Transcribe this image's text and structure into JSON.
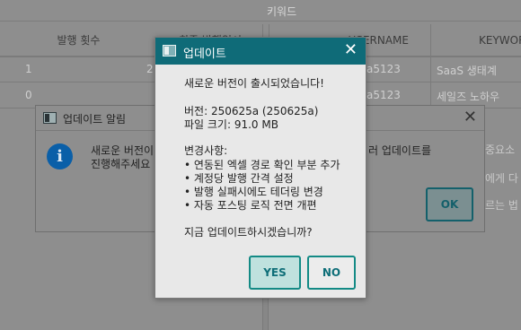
{
  "background": {
    "keyword_header": "키워드",
    "table": {
      "col_publish_count": "발행 횟수",
      "col_recent_partial": "최종 발행일시",
      "col_username": "USERNAME",
      "col_keyword_partial": "KEYWORD",
      "rows": [
        {
          "publish_count": "1",
          "recent_partial": "2",
          "username_partial": "a5123",
          "keyword": "SaaS 생태계"
        },
        {
          "publish_count": "0",
          "recent_partial": "",
          "username_partial": "a5123",
          "keyword": "세일즈 노하우"
        }
      ]
    }
  },
  "notice_dialog": {
    "title": "업데이트 알림",
    "message_line1_partial": "새로운 버전이",
    "message_line2_partial": "진행해주세요",
    "right_text_partial": "러 업데이트를",
    "side_text1_partial": "중요소",
    "side_text2_partial": "에게 다",
    "side_text3_partial": "르는 법",
    "ok_label": "OK"
  },
  "update_dialog": {
    "title": "업데이트",
    "headline": "새로운 버전이 출시되었습니다!",
    "version_line": "버전: 250625a (250625a)",
    "size_line": "파일 크기: 91.0 MB",
    "changes_header": "변경사항:",
    "changes": [
      "• 연동된 엑셀 경로 확인 부분 추가",
      "• 계정당 발행 간격 설정",
      "• 발행 실패시에도 테더링 변경",
      "• 자동 포스팅 로직 전면 개편"
    ],
    "question": "지금 업데이트하시겠습니까?",
    "yes_label": "YES",
    "no_label": "NO"
  },
  "colors": {
    "accent": "#0f6b78",
    "button_border": "#138a85",
    "info_icon": "#0a5fa8"
  }
}
